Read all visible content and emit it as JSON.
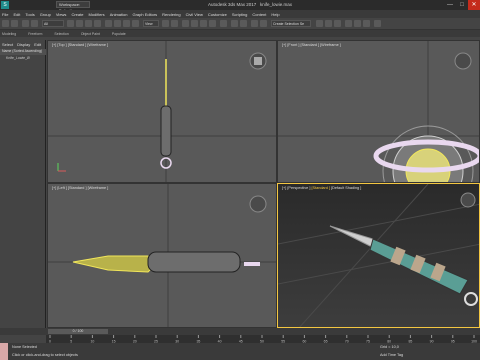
{
  "window": {
    "workspace_label": "Workspace: Default",
    "title": "Autodesk 3ds Max 2017",
    "filename": "knife_lowie.max",
    "close_glyph": "✕",
    "max_glyph": "□",
    "min_glyph": "—"
  },
  "menubar": {
    "items": [
      "File",
      "Edit",
      "Tools",
      "Group",
      "Views",
      "Create",
      "Modifiers",
      "Animation",
      "Graph Editors",
      "Rendering",
      "Civil View",
      "Customize",
      "Scripting",
      "Content",
      "Help"
    ]
  },
  "toolbar": {
    "selection_filter": "All",
    "view_dropdown": "View",
    "selection_set": "Create Selection Se"
  },
  "ribbon": {
    "tabs": [
      "Modeling",
      "Freeform",
      "Selection",
      "Object Paint",
      "Populate"
    ]
  },
  "scene_explorer": {
    "tabs": [
      "Select",
      "Display",
      "Edit"
    ],
    "header": "Name (Sorted Ascending)",
    "items": [
      "Knife_Lowie_Ø"
    ]
  },
  "viewports": {
    "top": {
      "label_a": "[+] [Top ]",
      "label_b": "[Standard ]",
      "label_c": "[Wireframe ]"
    },
    "front": {
      "label_a": "[+] [Front ]",
      "label_b": "[Standard ]",
      "label_c": "[Wireframe ]"
    },
    "left": {
      "label_a": "[+] [Left ]",
      "label_b": "[Standard ]",
      "label_c": "[Wireframe ]"
    },
    "persp": {
      "label_a": "[+] [Perspective ]",
      "label_b": "[Standard ]",
      "label_c": "[Default Shading ]"
    }
  },
  "timeline": {
    "frame_display": "0 / 100",
    "ticks": [
      "0",
      "5",
      "10",
      "15",
      "20",
      "25",
      "30",
      "35",
      "40",
      "45",
      "50",
      "55",
      "60",
      "65",
      "70",
      "75",
      "80",
      "85",
      "90",
      "95",
      "100"
    ]
  },
  "status": {
    "selection": "None Selected",
    "prompt": "Click or click-and-drag to select objects",
    "grid": "Grid = 10,0",
    "add_time_tag": "Add Time Tag"
  },
  "colors": {
    "accent": "#f3c641",
    "close": "#c42b1c"
  }
}
